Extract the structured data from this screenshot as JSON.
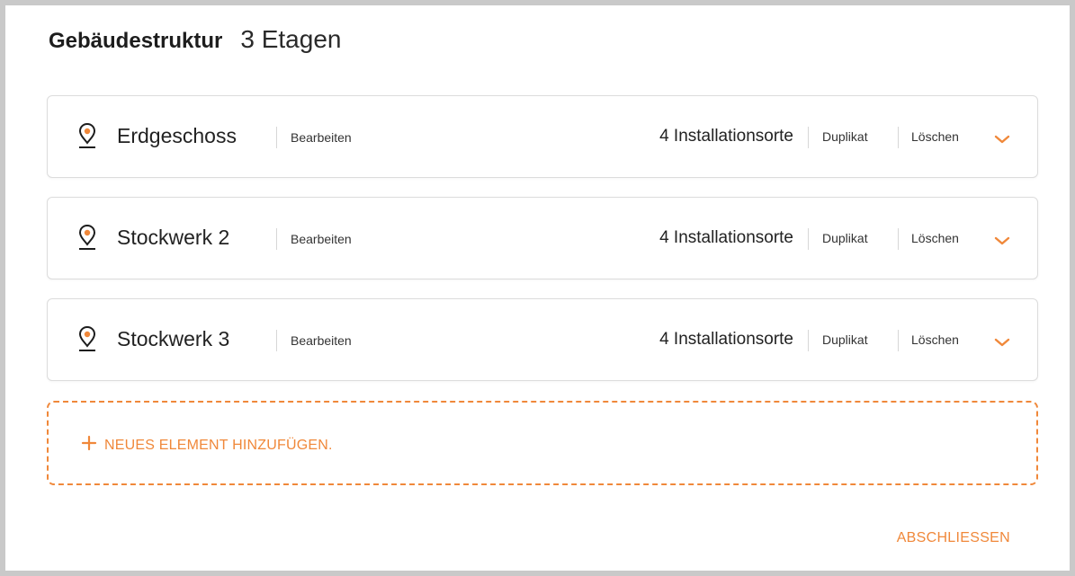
{
  "header": {
    "title": "Gebäudestruktur",
    "count": "3 Etagen"
  },
  "floors": [
    {
      "name": "Erdgeschoss",
      "edit_label": "Bearbeiten",
      "places": "4 Installationsorte",
      "duplicate_label": "Duplikat",
      "delete_label": "Löschen"
    },
    {
      "name": "Stockwerk 2",
      "edit_label": "Bearbeiten",
      "places": "4 Installationsorte",
      "duplicate_label": "Duplikat",
      "delete_label": "Löschen"
    },
    {
      "name": "Stockwerk 3",
      "edit_label": "Bearbeiten",
      "places": "4 Installationsorte",
      "duplicate_label": "Duplikat",
      "delete_label": "Löschen"
    }
  ],
  "add_element": {
    "label": "NEUES ELEMENT HINZUFÜGEN."
  },
  "footer": {
    "close_label": "ABSCHLIESSEN"
  },
  "colors": {
    "accent": "#f0883a",
    "text": "#1d1d1d",
    "border": "#dcdcdc",
    "frame": "#c9c9c9"
  },
  "icons": {
    "location": "location-pin-icon",
    "expand": "chevron-down-icon",
    "add": "plus-icon"
  }
}
